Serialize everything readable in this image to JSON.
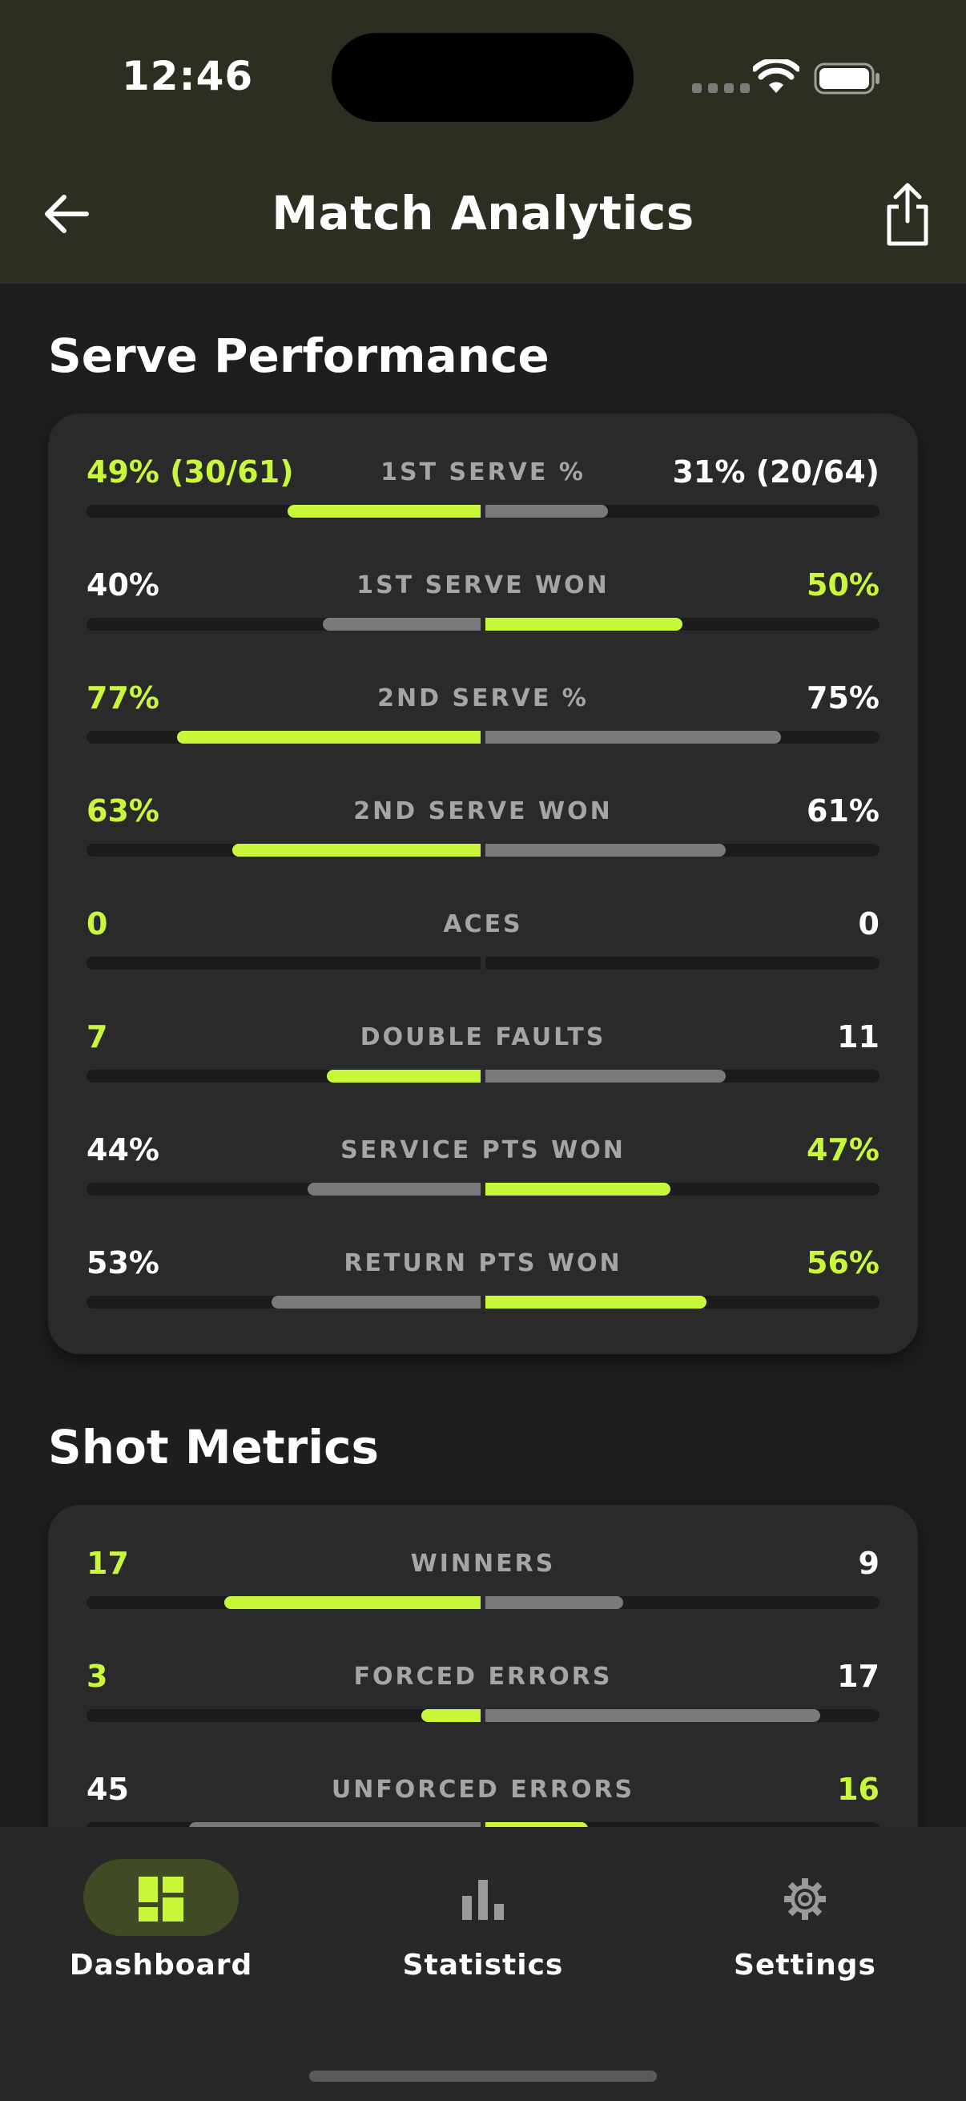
{
  "status_bar": {
    "time": "12:46"
  },
  "header": {
    "title": "Match Analytics"
  },
  "serve_performance": {
    "title": "Serve Performance",
    "rows": [
      {
        "label": "1ST SERVE %",
        "left": "49% (30/61)",
        "right": "31% (20/64)",
        "left_fill": 0.49,
        "right_fill": 0.31,
        "leader": "left"
      },
      {
        "label": "1ST SERVE WON",
        "left": "40%",
        "right": "50%",
        "left_fill": 0.4,
        "right_fill": 0.5,
        "leader": "right"
      },
      {
        "label": "2ND SERVE %",
        "left": "77%",
        "right": "75%",
        "left_fill": 0.77,
        "right_fill": 0.75,
        "leader": "left"
      },
      {
        "label": "2ND SERVE WON",
        "left": "63%",
        "right": "61%",
        "left_fill": 0.63,
        "right_fill": 0.61,
        "leader": "left"
      },
      {
        "label": "ACES",
        "left": "0",
        "right": "0",
        "left_fill": 0,
        "right_fill": 0,
        "leader": "left"
      },
      {
        "label": "DOUBLE FAULTS",
        "left": "7",
        "right": "11",
        "left_fill": 0.39,
        "right_fill": 0.61,
        "leader": "left"
      },
      {
        "label": "SERVICE PTS WON",
        "left": "44%",
        "right": "47%",
        "left_fill": 0.44,
        "right_fill": 0.47,
        "leader": "right"
      },
      {
        "label": "RETURN PTS WON",
        "left": "53%",
        "right": "56%",
        "left_fill": 0.53,
        "right_fill": 0.56,
        "leader": "right"
      }
    ]
  },
  "shot_metrics": {
    "title": "Shot Metrics",
    "rows": [
      {
        "label": "WINNERS",
        "left": "17",
        "right": "9",
        "left_fill": 0.65,
        "right_fill": 0.35,
        "leader": "left"
      },
      {
        "label": "FORCED ERRORS",
        "left": "3",
        "right": "17",
        "left_fill": 0.15,
        "right_fill": 0.85,
        "leader": "left"
      },
      {
        "label": "UNFORCED ERRORS",
        "left": "45",
        "right": "16",
        "left_fill": 0.74,
        "right_fill": 0.26,
        "leader": "right"
      }
    ]
  },
  "bottom_nav": {
    "items": [
      {
        "label": "Dashboard",
        "icon": "dashboard-icon",
        "active": true
      },
      {
        "label": "Statistics",
        "icon": "bar-chart-icon",
        "active": false
      },
      {
        "label": "Settings",
        "icon": "gear-icon",
        "active": false
      }
    ]
  },
  "colors": {
    "accent": "#c9f73a",
    "header_bg": "#2b2e21",
    "page_bg": "#1e1e1e",
    "card_bg": "#2a2a2a",
    "muted_bar": "#7a7a7a"
  }
}
